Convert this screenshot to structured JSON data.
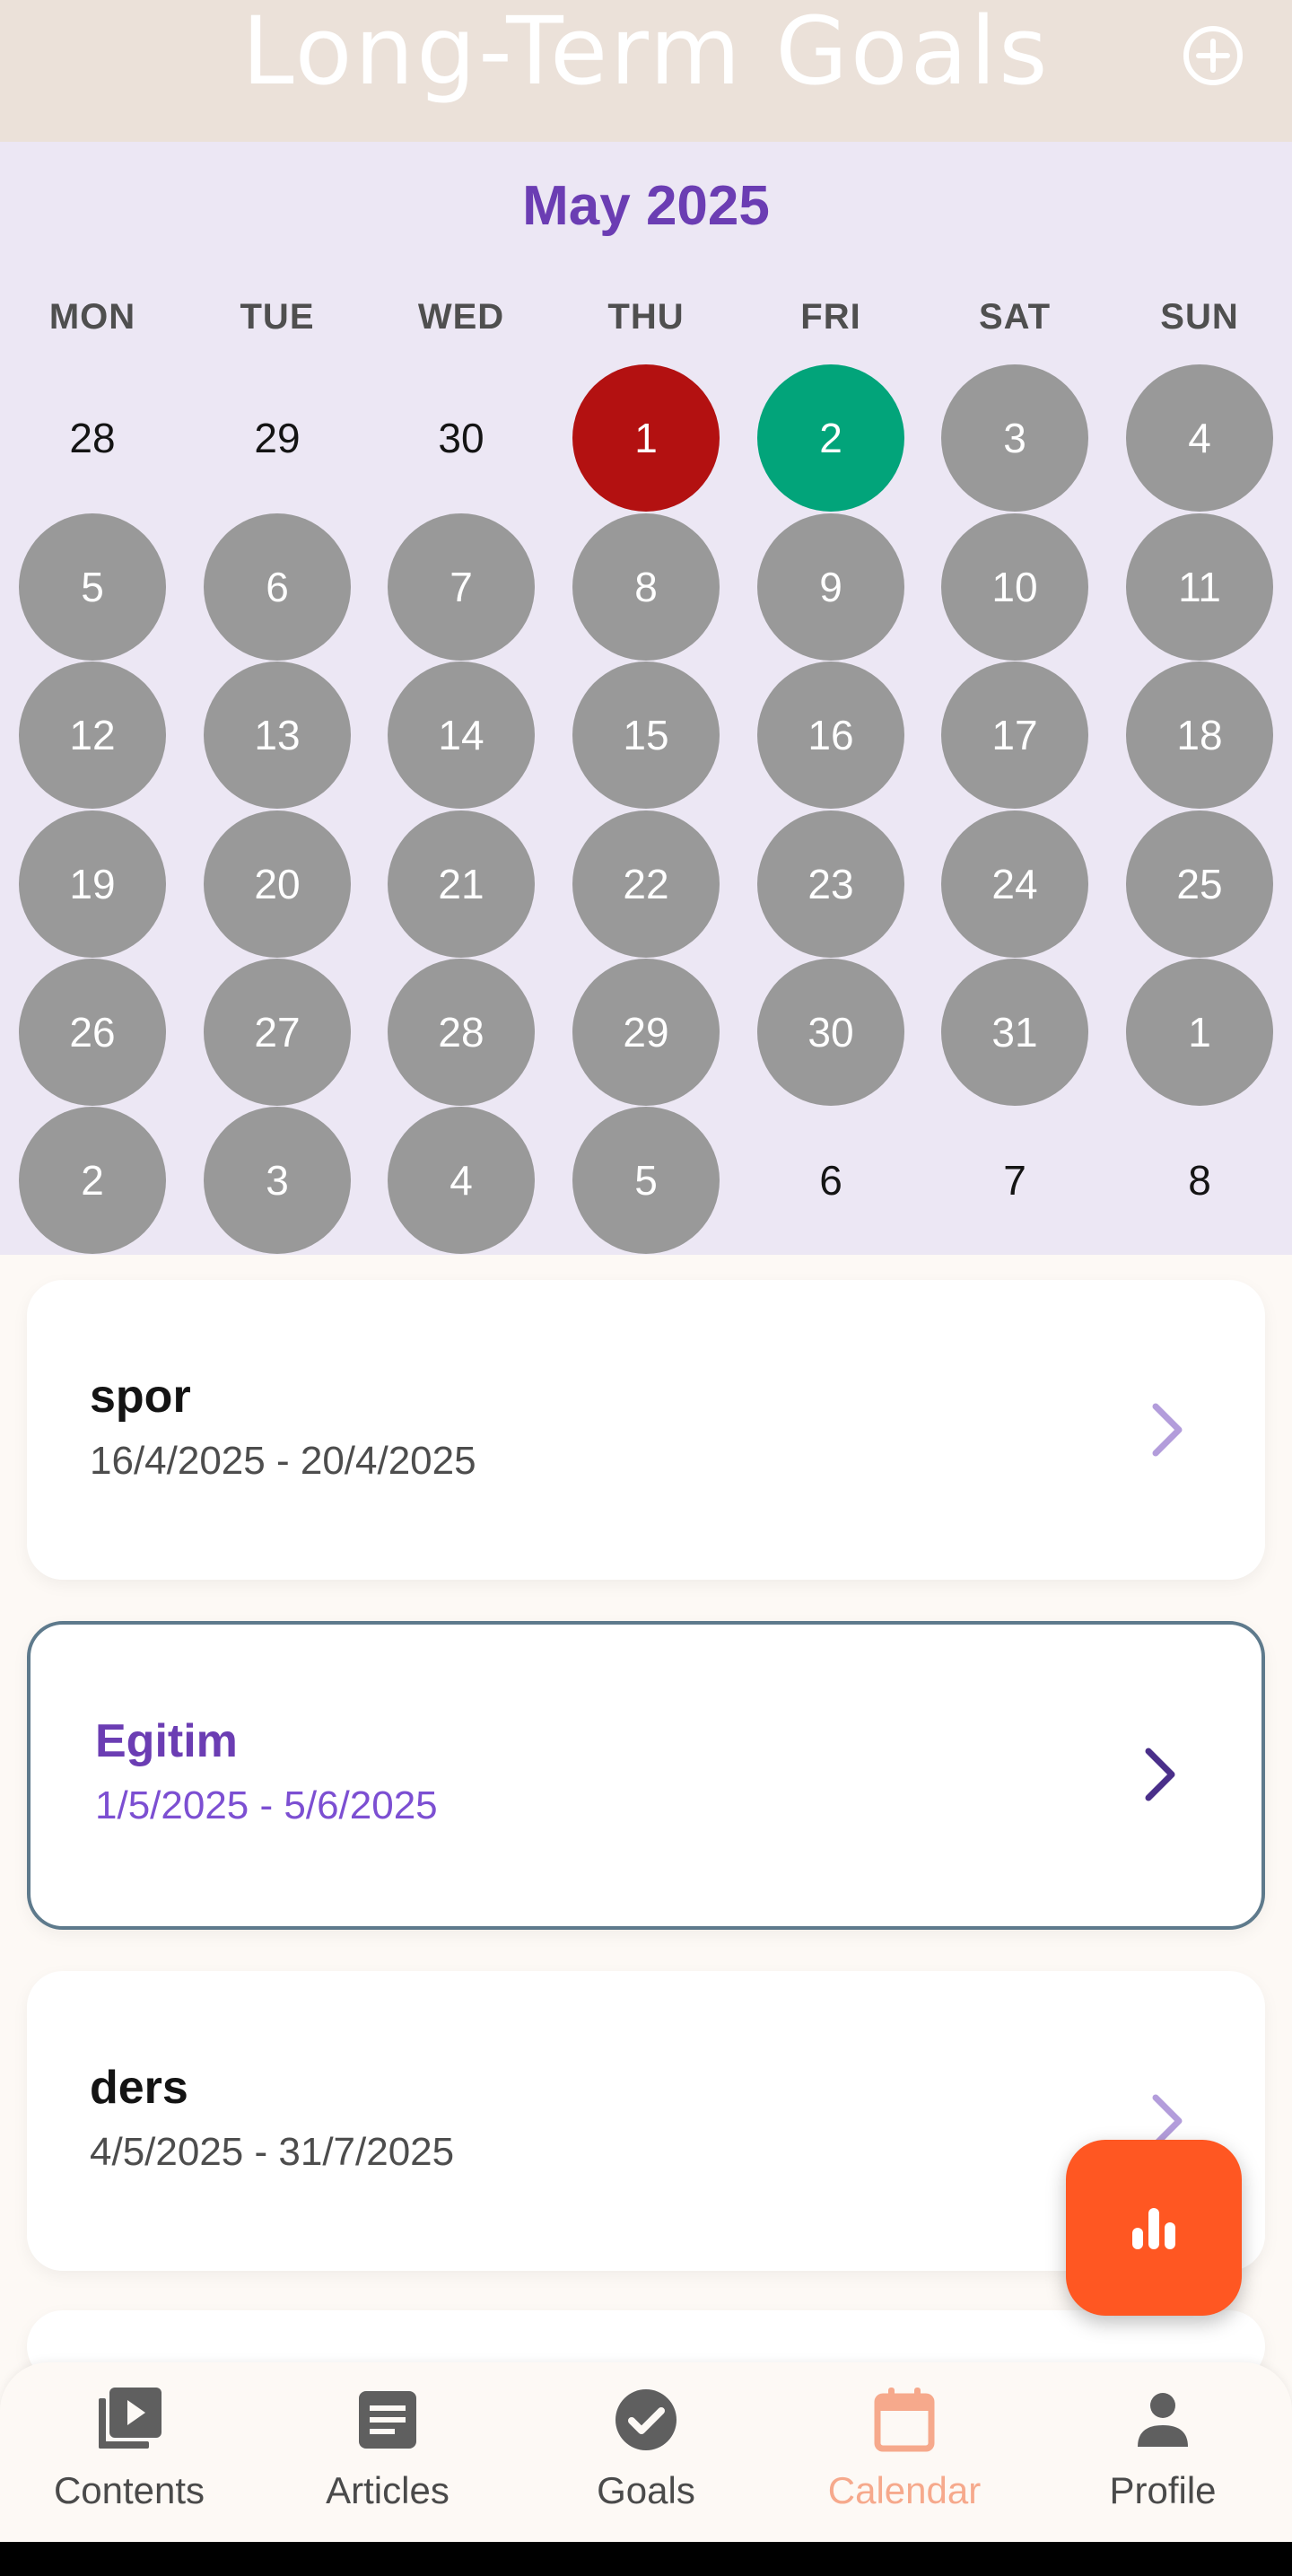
{
  "header": {
    "title": "Long-Term Goals",
    "add_icon": "add-circle-icon"
  },
  "calendar": {
    "month_title": "May 2025",
    "weekdays": [
      "MON",
      "TUE",
      "WED",
      "THU",
      "FRI",
      "SAT",
      "SUN"
    ],
    "days": [
      {
        "label": "28",
        "state": "plain"
      },
      {
        "label": "29",
        "state": "plain"
      },
      {
        "label": "30",
        "state": "plain"
      },
      {
        "label": "1",
        "state": "red"
      },
      {
        "label": "2",
        "state": "green"
      },
      {
        "label": "3",
        "state": "gray"
      },
      {
        "label": "4",
        "state": "gray"
      },
      {
        "label": "5",
        "state": "gray"
      },
      {
        "label": "6",
        "state": "gray"
      },
      {
        "label": "7",
        "state": "gray"
      },
      {
        "label": "8",
        "state": "gray"
      },
      {
        "label": "9",
        "state": "gray"
      },
      {
        "label": "10",
        "state": "gray"
      },
      {
        "label": "11",
        "state": "gray"
      },
      {
        "label": "12",
        "state": "gray"
      },
      {
        "label": "13",
        "state": "gray"
      },
      {
        "label": "14",
        "state": "gray"
      },
      {
        "label": "15",
        "state": "gray"
      },
      {
        "label": "16",
        "state": "gray"
      },
      {
        "label": "17",
        "state": "gray"
      },
      {
        "label": "18",
        "state": "gray"
      },
      {
        "label": "19",
        "state": "gray"
      },
      {
        "label": "20",
        "state": "gray"
      },
      {
        "label": "21",
        "state": "gray"
      },
      {
        "label": "22",
        "state": "gray"
      },
      {
        "label": "23",
        "state": "gray"
      },
      {
        "label": "24",
        "state": "gray"
      },
      {
        "label": "25",
        "state": "gray"
      },
      {
        "label": "26",
        "state": "gray"
      },
      {
        "label": "27",
        "state": "gray"
      },
      {
        "label": "28",
        "state": "gray"
      },
      {
        "label": "29",
        "state": "gray"
      },
      {
        "label": "30",
        "state": "gray"
      },
      {
        "label": "31",
        "state": "gray"
      },
      {
        "label": "1",
        "state": "gray"
      },
      {
        "label": "2",
        "state": "gray"
      },
      {
        "label": "3",
        "state": "gray"
      },
      {
        "label": "4",
        "state": "gray"
      },
      {
        "label": "5",
        "state": "gray"
      },
      {
        "label": "6",
        "state": "plain"
      },
      {
        "label": "7",
        "state": "plain"
      },
      {
        "label": "8",
        "state": "plain"
      }
    ]
  },
  "goals": [
    {
      "name": "spor",
      "dates": "16/4/2025 - 20/4/2025",
      "selected": false
    },
    {
      "name": "Egitim",
      "dates": "1/5/2025 - 5/6/2025",
      "selected": true
    },
    {
      "name": "ders",
      "dates": "4/5/2025 - 31/7/2025",
      "selected": false
    }
  ],
  "fab": {
    "icon": "bar-chart-icon"
  },
  "nav": {
    "items": [
      {
        "label": "Contents",
        "icon": "video-library-icon"
      },
      {
        "label": "Articles",
        "icon": "article-icon"
      },
      {
        "label": "Goals",
        "icon": "check-circle-icon"
      },
      {
        "label": "Calendar",
        "icon": "calendar-icon",
        "active": true
      },
      {
        "label": "Profile",
        "icon": "person-icon"
      }
    ]
  },
  "colors": {
    "header_bg": "#EBE1D9",
    "calendar_bg": "#ECE7F4",
    "accent_purple": "#6B3DB3",
    "day_gray": "#999999",
    "day_red": "#B31111",
    "day_green": "#02A47A",
    "fab_orange": "#FF5722",
    "nav_active": "#F6A98C"
  }
}
